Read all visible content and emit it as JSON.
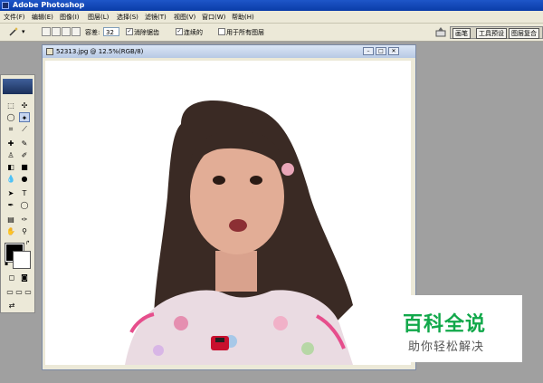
{
  "app": {
    "title": "Adobe Photoshop"
  },
  "menu": [
    "文件(F)",
    "编辑(E)",
    "图像(I)",
    "图层(L)",
    "选择(S)",
    "滤镜(T)",
    "视图(V)",
    "窗口(W)",
    "帮助(H)"
  ],
  "options": {
    "tolerance_label": "容差:",
    "tolerance_value": "32",
    "antialias_label": "消除锯齿",
    "antialias_checked": "✓",
    "contiguous_label": "连续的",
    "contiguous_checked": "✓",
    "all_layers_label": "用于所有图层"
  },
  "panel_tabs": [
    "画笔",
    "工具预设",
    "图层复合"
  ],
  "document": {
    "title": "52313.jpg @ 12.5%(RGB/8)"
  },
  "colors": {
    "foreground": "#000000",
    "background": "#ffffff"
  },
  "watermark": {
    "title": "百科全说",
    "subtitle": "助你轻松解决"
  }
}
